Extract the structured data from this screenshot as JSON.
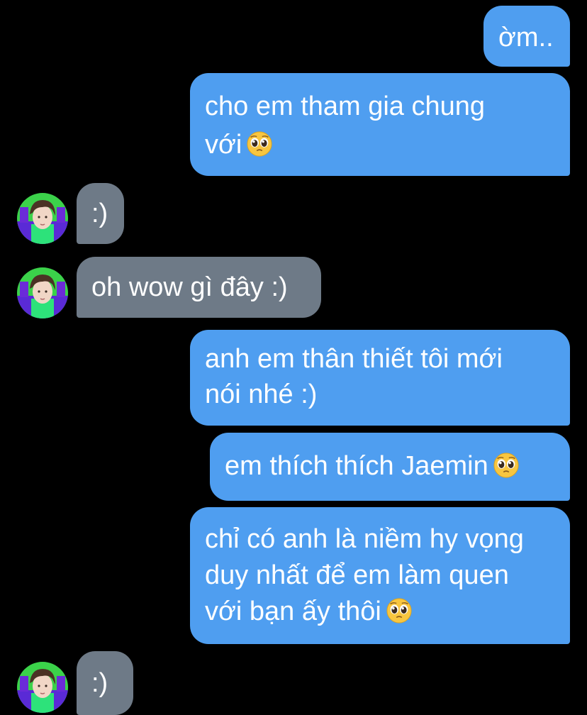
{
  "colors": {
    "background": "#000000",
    "outgoing_bubble": "#4f9ef0",
    "incoming_bubble": "#6e7a87",
    "text": "#ffffff"
  },
  "messages": [
    {
      "direction": "outgoing",
      "lines": [
        "ờm.."
      ]
    },
    {
      "direction": "outgoing",
      "lines": [
        "cho em tham gia chung",
        "với"
      ],
      "emoji": "pleading-face-icon"
    },
    {
      "direction": "incoming",
      "lines": [
        ":)"
      ],
      "avatar": "contact-avatar"
    },
    {
      "direction": "incoming",
      "lines": [
        "oh wow gì đây :)"
      ],
      "avatar": "contact-avatar"
    },
    {
      "direction": "outgoing",
      "lines": [
        "anh em thân thiết tôi mới",
        "nói nhé :)"
      ]
    },
    {
      "direction": "outgoing",
      "lines": [
        "em thích thích Jaemin"
      ],
      "emoji": "pleading-face-icon"
    },
    {
      "direction": "outgoing",
      "lines": [
        "chỉ có anh là niềm hy vọng",
        "duy nhất để em làm quen",
        "với bạn ấy thôi"
      ],
      "emoji": "pleading-face-icon"
    },
    {
      "direction": "incoming",
      "lines": [
        ":)"
      ],
      "avatar": "contact-avatar"
    }
  ]
}
